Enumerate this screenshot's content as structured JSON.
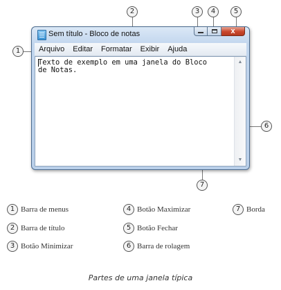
{
  "window": {
    "title": "Sem título - Bloco de notas",
    "close_glyph": "x",
    "menu": [
      "Arquivo",
      "Editar",
      "Formatar",
      "Exibir",
      "Ajuda"
    ],
    "text_line1": "Texto de exemplo em uma janela do Bloco",
    "text_line2": "de Notas."
  },
  "callouts": [
    "1",
    "2",
    "3",
    "4",
    "5",
    "6",
    "7"
  ],
  "legend": [
    {
      "num": "1",
      "label": "Barra de menus"
    },
    {
      "num": "2",
      "label": "Barra de título"
    },
    {
      "num": "3",
      "label": "Botão Minimizar"
    },
    {
      "num": "4",
      "label": "Botão Maximizar"
    },
    {
      "num": "5",
      "label": "Botão Fechar"
    },
    {
      "num": "6",
      "label": "Barra de rolagem"
    },
    {
      "num": "7",
      "label": "Borda"
    }
  ],
  "caption": "Partes de uma janela típica"
}
